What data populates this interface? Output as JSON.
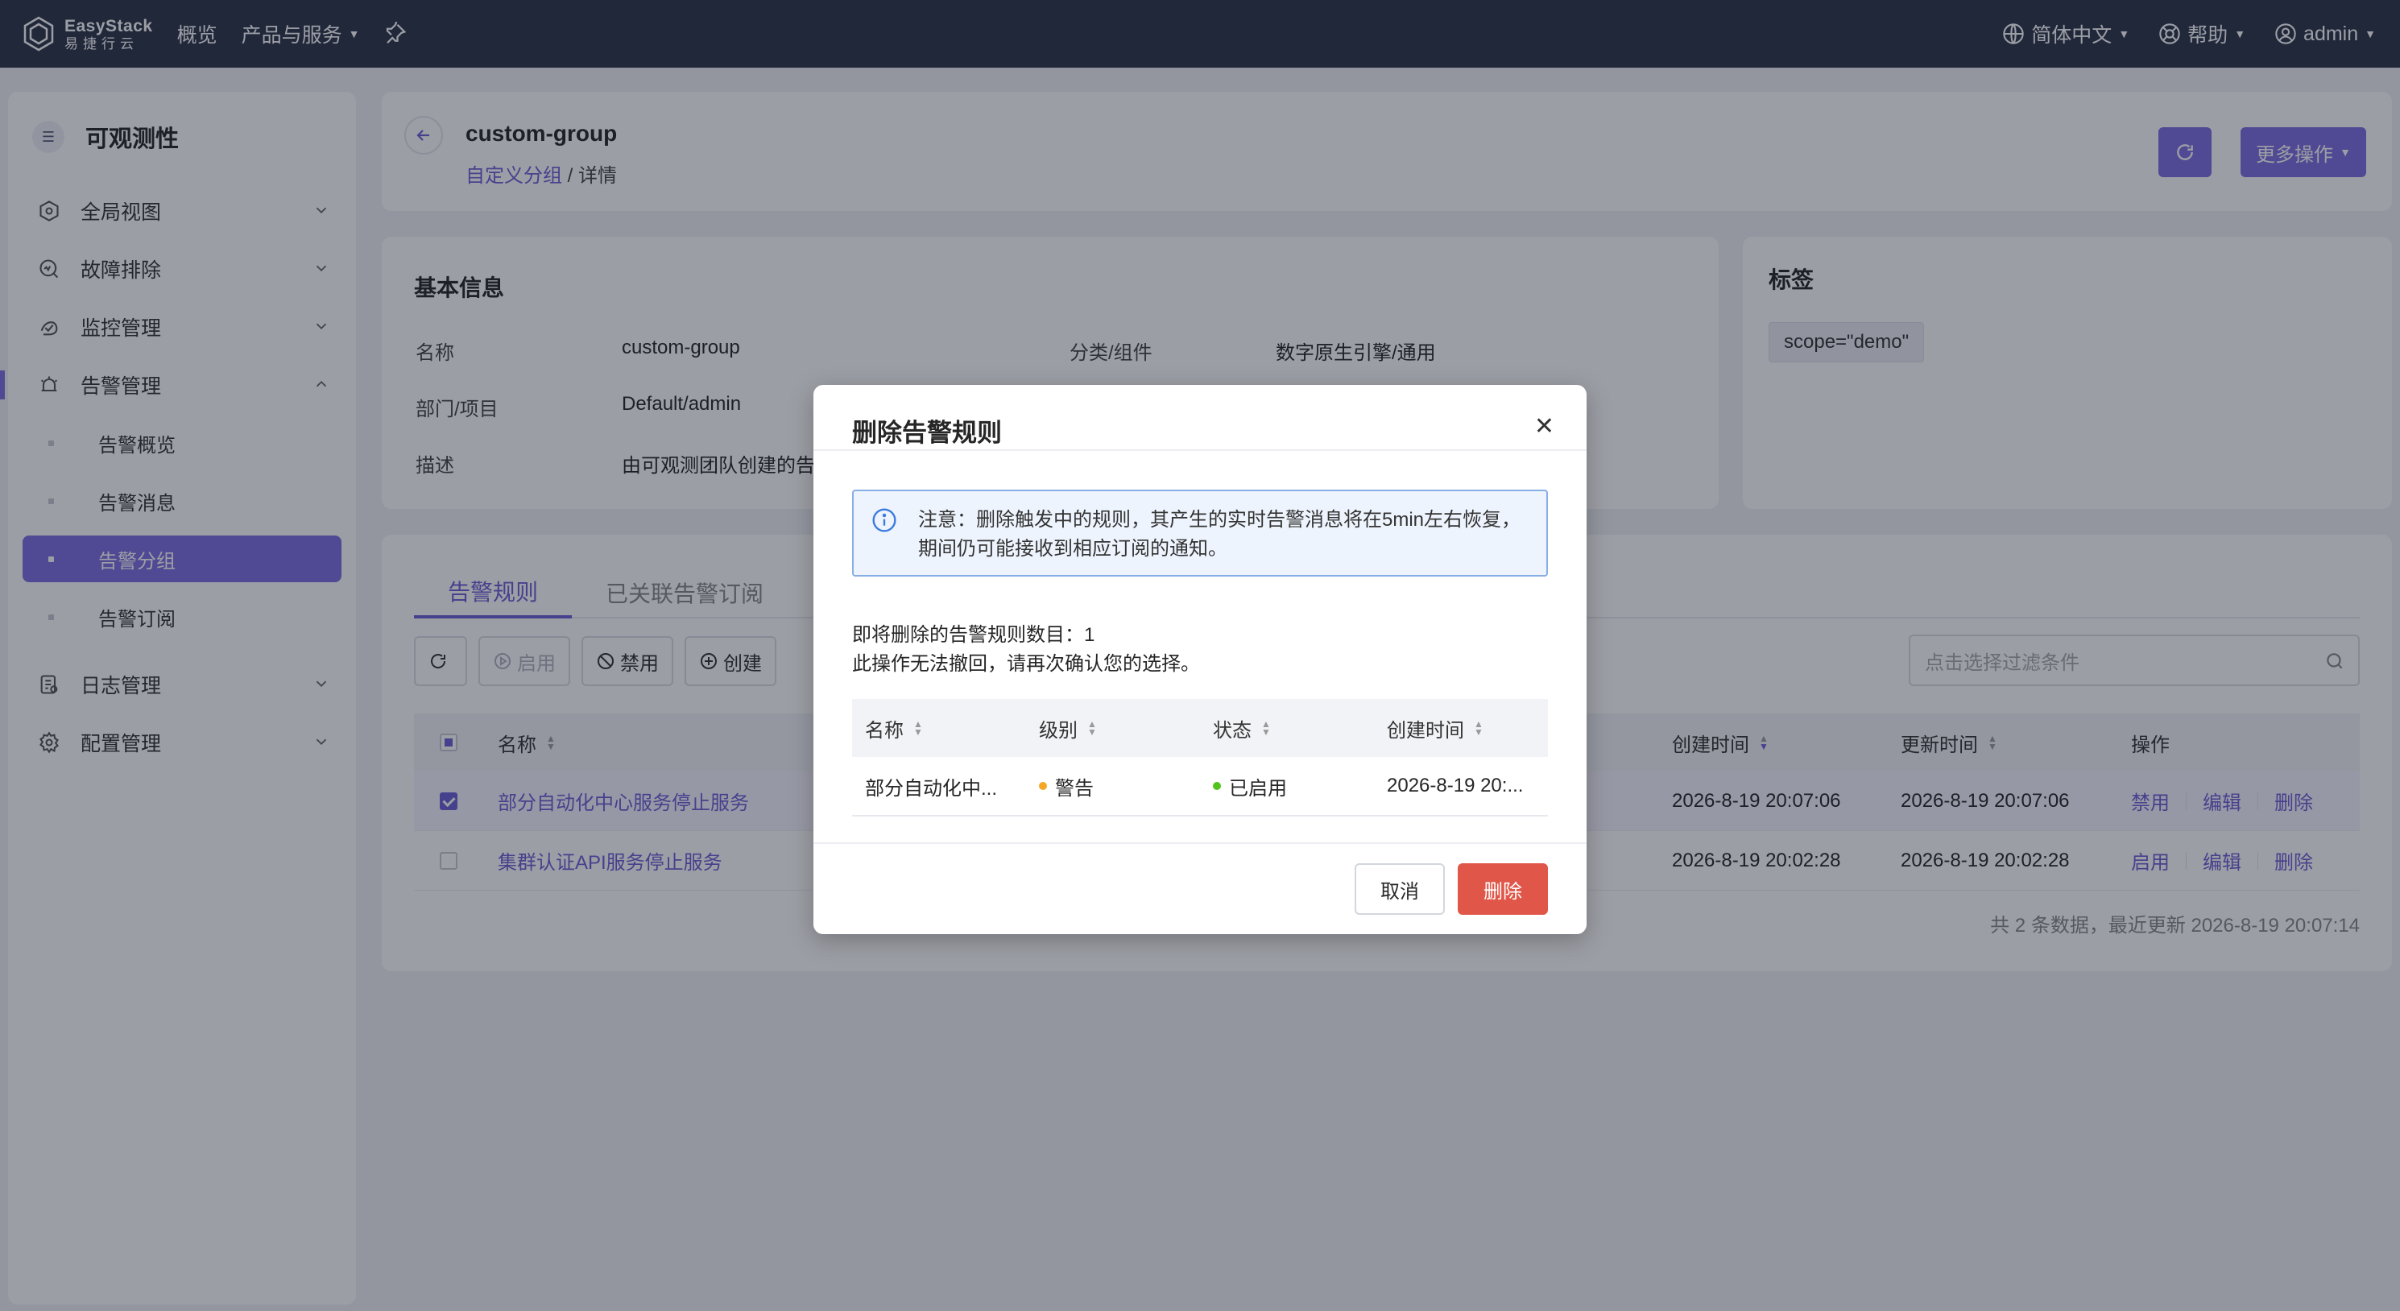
{
  "topbar": {
    "logo_en": "EasyStack",
    "logo_cn": "易捷行云",
    "nav": [
      "概览",
      "产品与服务"
    ],
    "language": "简体中文",
    "help": "帮助",
    "user": "admin"
  },
  "sidebar": {
    "title": "可观测性",
    "items": [
      {
        "label": "全局视图",
        "icon": "dashboard-icon"
      },
      {
        "label": "故障排除",
        "icon": "troubleshoot-icon"
      },
      {
        "label": "监控管理",
        "icon": "monitor-icon"
      },
      {
        "label": "告警管理",
        "icon": "alarm-icon"
      },
      {
        "label": "日志管理",
        "icon": "log-icon"
      },
      {
        "label": "配置管理",
        "icon": "settings-icon"
      }
    ],
    "alarm_sub": [
      "告警概览",
      "告警消息",
      "告警分组",
      "告警订阅"
    ]
  },
  "header": {
    "title": "custom-group",
    "breadcrumb_link": "自定义分组",
    "breadcrumb_sep": "/",
    "breadcrumb_current": "详情",
    "more_actions": "更多操作"
  },
  "basic_info": {
    "title": "基本信息",
    "name_label": "名称",
    "name_value": "custom-group",
    "dept_label": "部门/项目",
    "dept_value": "Default/admin",
    "desc_label": "描述",
    "desc_value": "由可观测团队创建的告",
    "category_label": "分类/组件",
    "category_value": "数字原生引擎/通用"
  },
  "tags": {
    "title": "标签",
    "items": [
      "scope=\"demo\""
    ]
  },
  "rules": {
    "tabs": [
      "告警规则",
      "已关联告警订阅"
    ],
    "toolbar": {
      "enable": "启用",
      "disable": "禁用",
      "create": "创建"
    },
    "filter_placeholder": "点击选择过滤条件",
    "columns": {
      "name": "名称",
      "created": "创建时间",
      "updated": "更新时间",
      "ops": "操作"
    },
    "rows": [
      {
        "name": "部分自动化中心服务停止服务",
        "created": "2026-8-19 20:07:06",
        "updated": "2026-8-19 20:07:06",
        "op1": "禁用",
        "op2": "编辑",
        "op3": "删除",
        "checked": true
      },
      {
        "name": "集群认证API服务停止服务",
        "created": "2026-8-19 20:02:28",
        "updated": "2026-8-19 20:02:28",
        "op1": "启用",
        "op2": "编辑",
        "op3": "删除",
        "checked": false
      }
    ],
    "footer": "共 2 条数据，最近更新   2026-8-19 20:07:14"
  },
  "modal": {
    "title": "删除告警规则",
    "notice": "注意：删除触发中的规则，其产生的实时告警消息将在5min左右恢复，期间仍可能接收到相应订阅的通知。",
    "count_line": "即将删除的告警规则数目：1",
    "warn_line": "此操作无法撤回，请再次确认您的选择。",
    "columns": {
      "name": "名称",
      "level": "级别",
      "status": "状态",
      "created": "创建时间"
    },
    "row": {
      "name": "部分自动化中...",
      "level": "警告",
      "status": "已启用",
      "created": "2026-8-19 20:..."
    },
    "cancel": "取消",
    "delete": "删除"
  },
  "colors": {
    "accent": "#7a6ee0",
    "topbar": "#2b3448",
    "danger": "#e0574a",
    "warning_dot": "#f5a623",
    "enabled_dot": "#52c41a"
  }
}
